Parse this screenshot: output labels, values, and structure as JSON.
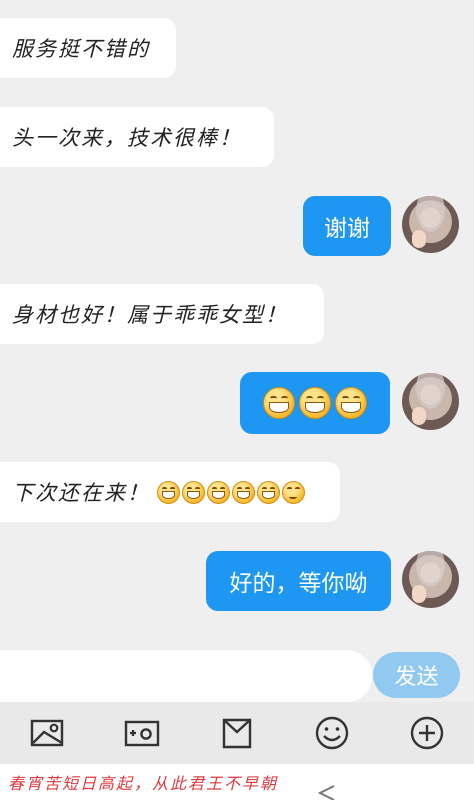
{
  "messages": {
    "m1": "服务挺不错的",
    "m2": "头一次来，技术很棒！",
    "m3": "谢谢",
    "m4": "身材也好！属于乖乖女型！",
    "m6": "下次还在来！",
    "m7": "好的，等你呦"
  },
  "emojis": {
    "grin": "grinning-face-emoji",
    "sly": "smirk-face-emoji"
  },
  "input": {
    "placeholder": "",
    "send_label": "发送"
  },
  "toolbar": [
    "image-icon",
    "camera-icon",
    "video-icon",
    "emoji-icon",
    "add-icon"
  ],
  "footer": {
    "text": "春宵苦短日高起，从此君王不早朝"
  },
  "colors": {
    "outgoing_bubble": "#1e97f2",
    "send_button": "#92c9f0",
    "footer_text": "#e0393e"
  }
}
